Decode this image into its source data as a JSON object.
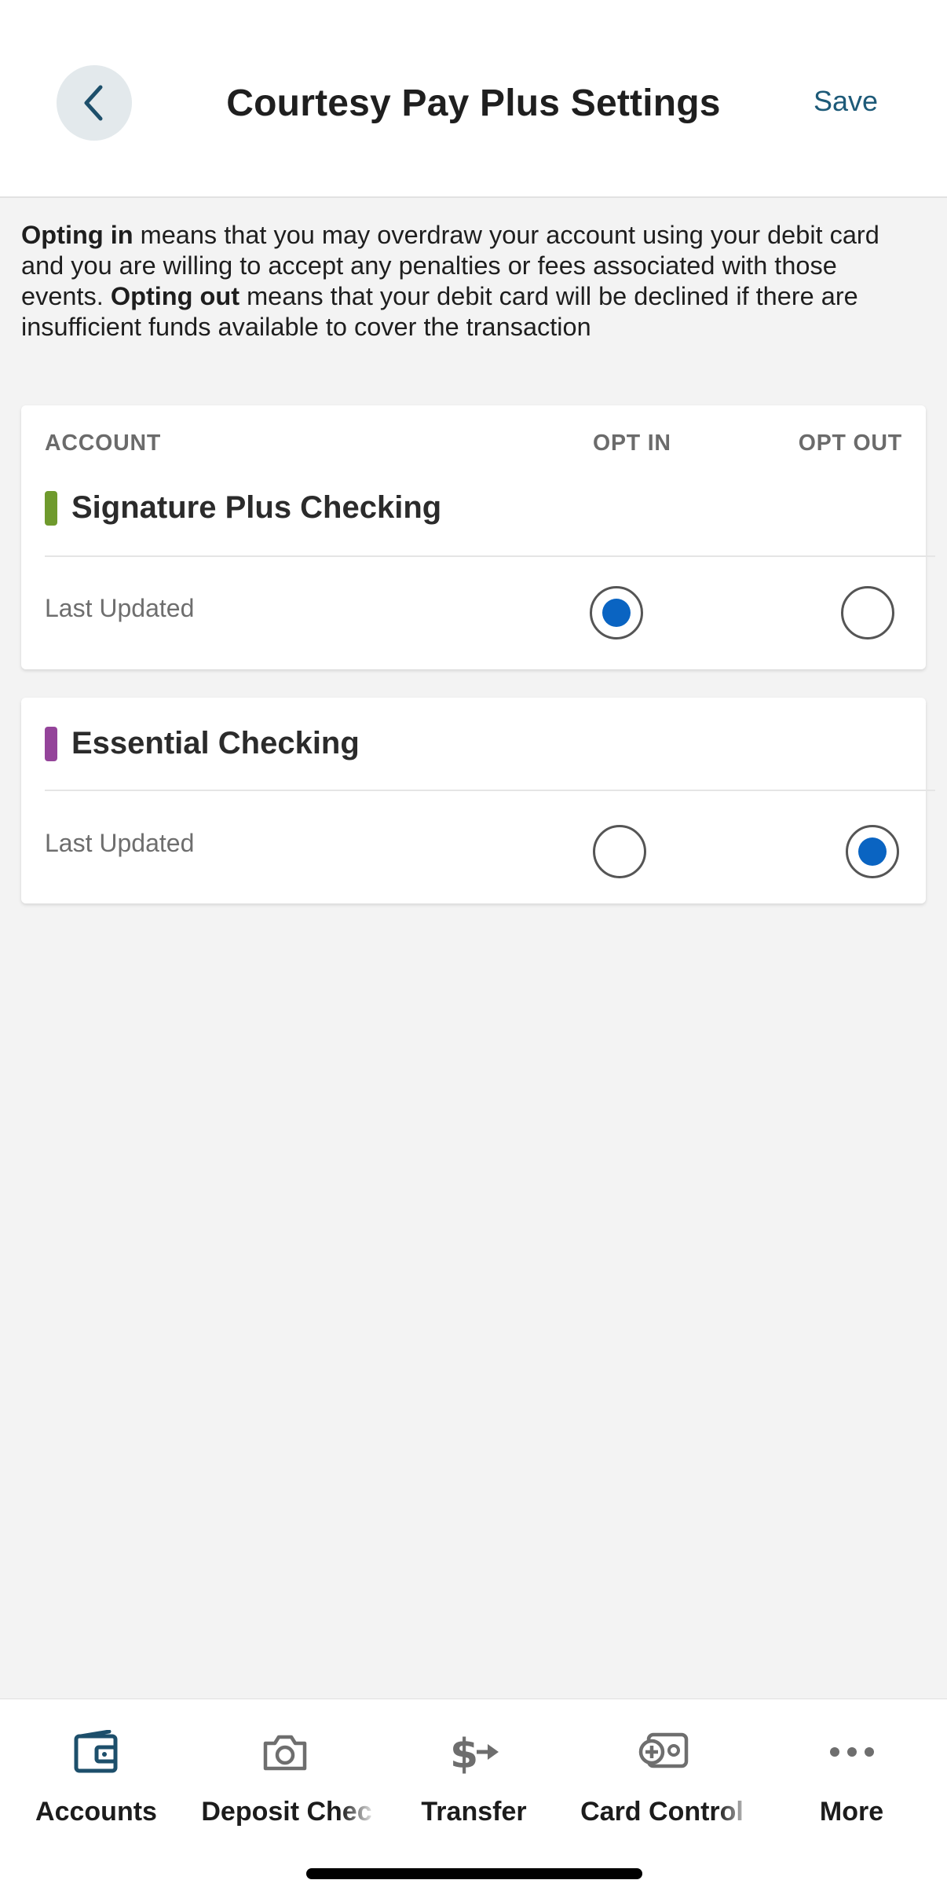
{
  "header": {
    "title": "Courtesy Pay Plus Settings",
    "save_label": "Save",
    "back_icon": "chevron-left-icon"
  },
  "intro": {
    "opting_in_bold": "Opting in",
    "opting_in_text": " means that you may overdraw your account using your debit card and you are willing to accept any penalties or fees associated with those events. ",
    "opting_out_bold": "Opting out",
    "opting_out_text": " means that your debit card will be declined if there are insufficient funds available to cover the transaction"
  },
  "table": {
    "col_account": "ACCOUNT",
    "col_opt_in": "OPT IN",
    "col_opt_out": "OPT OUT"
  },
  "accounts": [
    {
      "name": "Signature Plus Checking",
      "color": "#6f9a2d",
      "last_updated_label": "Last Updated",
      "selection": "opt_in"
    },
    {
      "name": "Essential Checking",
      "color": "#94449a",
      "last_updated_label": "Last Updated",
      "selection": "opt_out"
    }
  ],
  "tabs": [
    {
      "label": "Accounts",
      "icon": "wallet-icon"
    },
    {
      "label": "Deposit Chec",
      "icon": "camera-icon"
    },
    {
      "label": "Transfer",
      "icon": "dollar-arrow-icon"
    },
    {
      "label": "Card Control",
      "icon": "card-plus-icon"
    },
    {
      "label": "More",
      "icon": "more-dots-icon"
    }
  ],
  "colors": {
    "accent_blue": "#0a64c2",
    "brand_teal": "#1d5a78",
    "active_tab_icon": "#1d4f6b",
    "inactive_tab_icon": "#6e6e6e"
  }
}
